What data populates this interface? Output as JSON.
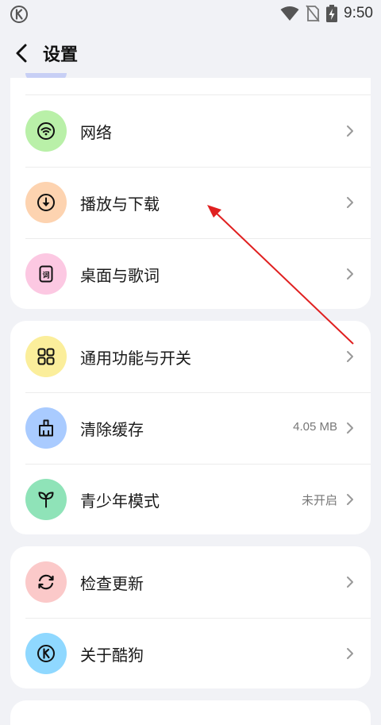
{
  "status_bar": {
    "time": "9:50",
    "app_icon": "kugou-k-icon",
    "icons": [
      "wifi-icon",
      "no-sim-icon",
      "battery-charging-icon"
    ]
  },
  "header": {
    "title": "设置",
    "back_icon": "back-arrow-icon"
  },
  "sections": [
    {
      "items": [
        {
          "label": "网络",
          "icon": "wifi-icon",
          "icon_bg": "#b9f0a8",
          "value": ""
        },
        {
          "label": "播放与下载",
          "icon": "download-icon",
          "icon_bg": "#fdd3b0",
          "value": ""
        },
        {
          "label": "桌面与歌词",
          "icon": "lyrics-icon",
          "icon_bg": "#fcc8e2",
          "value": ""
        }
      ]
    },
    {
      "items": [
        {
          "label": "通用功能与开关",
          "icon": "grid-icon",
          "icon_bg": "#fbee9b",
          "value": ""
        },
        {
          "label": "清除缓存",
          "icon": "broom-icon",
          "icon_bg": "#a9cbff",
          "value": "4.05 MB"
        },
        {
          "label": "青少年模式",
          "icon": "sprout-icon",
          "icon_bg": "#8fe3b8",
          "value": "未开启"
        }
      ]
    },
    {
      "items": [
        {
          "label": "检查更新",
          "icon": "refresh-icon",
          "icon_bg": "#fbc9c9",
          "value": ""
        },
        {
          "label": "关于酷狗",
          "icon": "kugou-k-icon",
          "icon_bg": "#8fd8ff",
          "value": ""
        }
      ]
    }
  ],
  "colors": {
    "background": "#f1f2f6",
    "card": "#ffffff",
    "annotation_arrow": "#e02020"
  }
}
